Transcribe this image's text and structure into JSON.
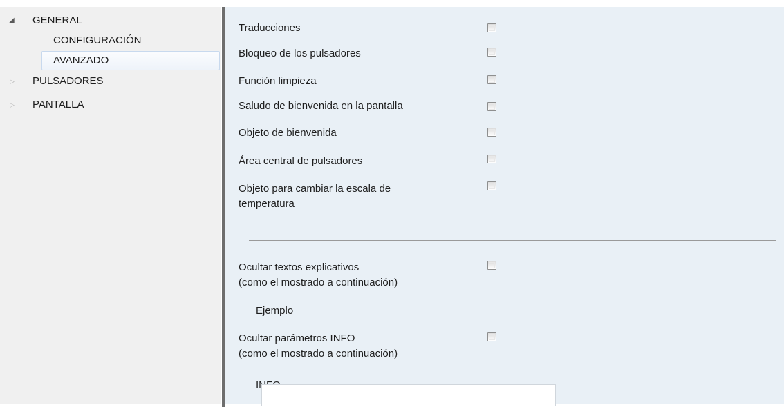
{
  "tree": {
    "items": [
      {
        "label": "GENERAL",
        "expanded": true
      },
      {
        "label": "CONFIGURACIÓN"
      },
      {
        "label": "AVANZADO",
        "selected": true
      },
      {
        "label": "PULSADORES",
        "expanded": false
      },
      {
        "label": "PANTALLA",
        "expanded": false
      }
    ]
  },
  "params": {
    "rows": [
      {
        "label": "Traducciones",
        "checked": false
      },
      {
        "label": "Bloqueo de los pulsadores",
        "checked": false
      },
      {
        "label": "Función limpieza",
        "checked": false
      },
      {
        "label": "Saludo de bienvenida en la pantalla",
        "checked": false
      },
      {
        "label": "Objeto de bienvenida",
        "checked": false
      },
      {
        "label": "Área central de pulsadores",
        "checked": false
      },
      {
        "label_line1": "Objeto para cambiar la escala de",
        "label_line2": "temperatura",
        "checked": false
      }
    ],
    "hide_texts": {
      "line1": "Ocultar textos explicativos",
      "line2": "(como el mostrado a continuación)",
      "checked": false
    },
    "example_label": "Ejemplo",
    "hide_info": {
      "line1": "Ocultar parámetros INFO",
      "line2": "(como el mostrado a continuación)",
      "checked": false
    },
    "info_label": "INFO",
    "info_value": ""
  }
}
